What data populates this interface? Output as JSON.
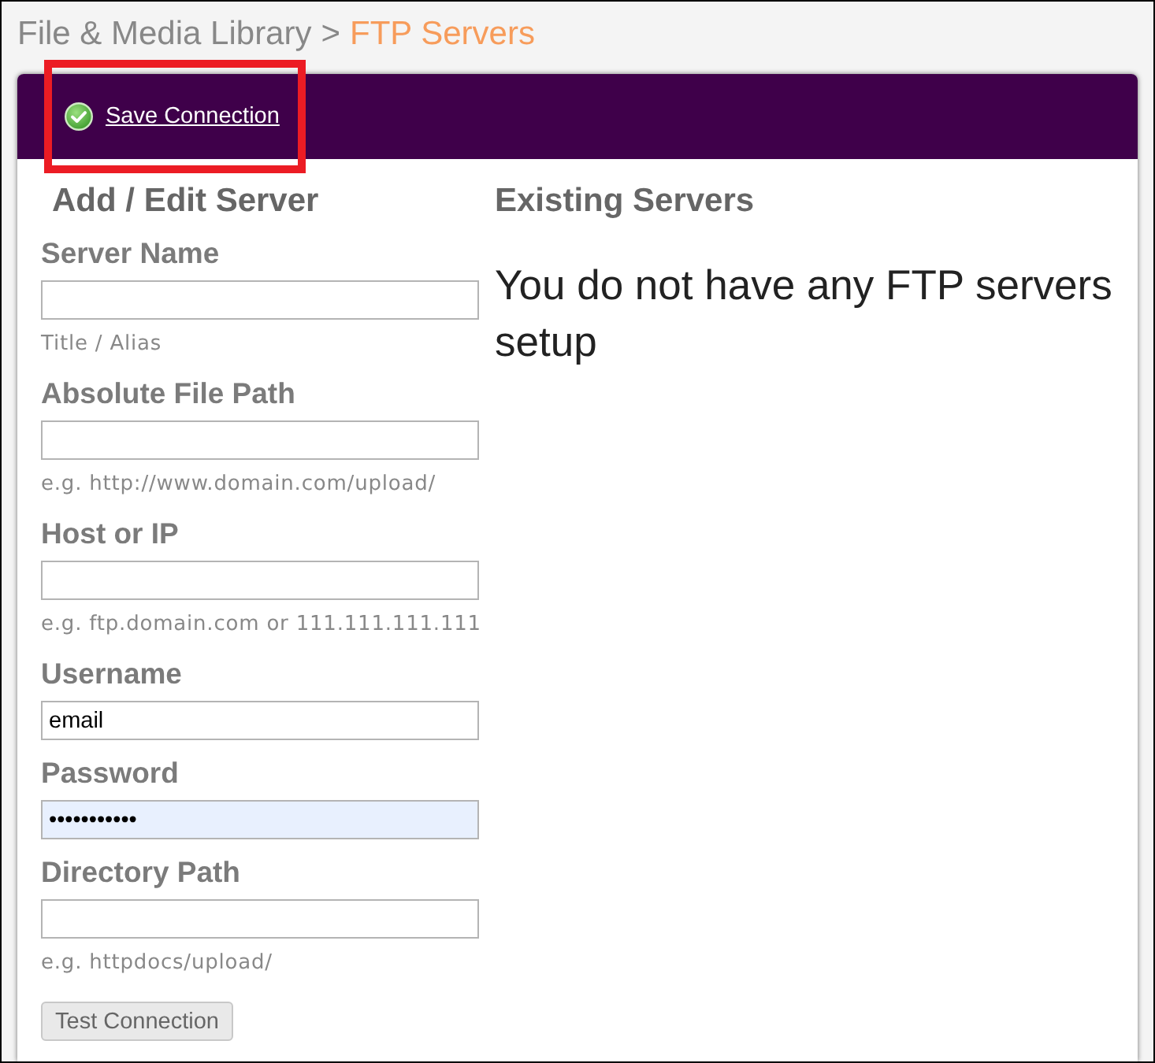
{
  "breadcrumb": {
    "separator": ">",
    "items": [
      {
        "label": "File & Media Library",
        "current": false
      },
      {
        "label": "FTP Servers",
        "current": true
      }
    ]
  },
  "toolbar": {
    "save_action": {
      "label": "Save Connection",
      "highlighted": true
    }
  },
  "form": {
    "title": "Add / Edit Server",
    "fields": [
      {
        "label": "Server Name",
        "hint": "Title / Alias",
        "autofilled": false
      },
      {
        "label": "Absolute File Path",
        "hint": "e.g. http://www.domain.com/upload/",
        "autofilled": false
      },
      {
        "label": "Host or IP",
        "hint": "e.g. ftp.domain.com or 111.111.111.111",
        "autofilled": false
      },
      {
        "label": "Username",
        "value": "email",
        "autofilled": false
      },
      {
        "label": "Password",
        "value": "•••••••••••",
        "autofilled": true
      },
      {
        "label": "Directory Path",
        "hint": "e.g. httpdocs/upload/",
        "autofilled": false
      }
    ],
    "test_button": {
      "label": "Test Connection"
    }
  },
  "existing_servers": {
    "title": "Existing Servers",
    "message": "You do not have any FTP servers setup"
  }
}
